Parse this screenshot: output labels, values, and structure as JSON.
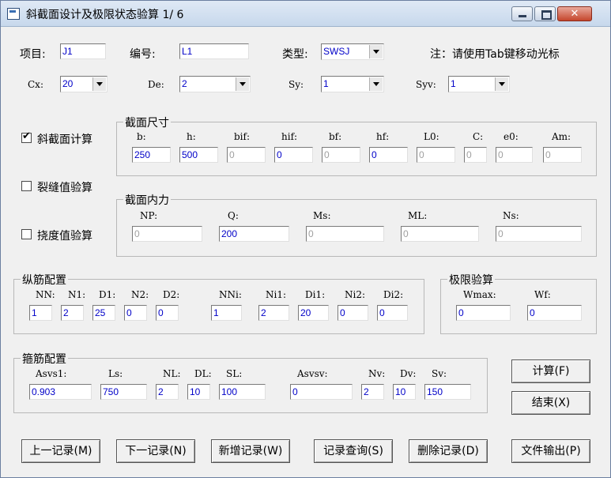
{
  "window": {
    "title": "斜截面设计及极限状态验算 1/ 6"
  },
  "top": {
    "item_label": "项目:",
    "item_value": "J1",
    "code_label": "编号:",
    "code_value": "L1",
    "type_label": "类型:",
    "type_value": "SWSJ",
    "note": "注：请使用Tab键移动光标",
    "cx_label": "Cx:",
    "cx_value": "20",
    "de_label": "De:",
    "de_value": "2",
    "sy_label": "Sy:",
    "sy_value": "1",
    "syv_label": "Syv:",
    "syv_value": "1"
  },
  "checks": {
    "oblique": "斜截面计算",
    "oblique_checked": "✔",
    "crack": "裂缝值验算",
    "deflection": "挠度值验算"
  },
  "section_size": {
    "title": "截面尺寸",
    "labels": [
      "b:",
      "h:",
      "bif:",
      "hif:",
      "bf:",
      "hf:",
      "L0:",
      "C:",
      "e0:",
      "Am:"
    ],
    "values": [
      "250",
      "500",
      "0",
      "0",
      "0",
      "0",
      "0",
      "0",
      "0",
      "0"
    ]
  },
  "section_force": {
    "title": "截面内力",
    "labels": [
      "NP:",
      "Q:",
      "Ms:",
      "ML:",
      "Ns:"
    ],
    "values": [
      "0",
      "200",
      "0",
      "0",
      "0"
    ]
  },
  "long_rebar": {
    "title": "纵筋配置",
    "labels": [
      "NN:",
      "N1:",
      "D1:",
      "N2:",
      "D2:",
      "NNi:",
      "Ni1:",
      "Di1:",
      "Ni2:",
      "Di2:"
    ],
    "values": [
      "1",
      "2",
      "25",
      "0",
      "0",
      "1",
      "2",
      "20",
      "0",
      "0"
    ]
  },
  "limit_check": {
    "title": "极限验算",
    "labels": [
      "Wmax:",
      "Wf:"
    ],
    "values": [
      "0",
      "0"
    ]
  },
  "stirrup": {
    "title": "箍筋配置",
    "labels": [
      "Asvs1:",
      "Ls:",
      "NL:",
      "DL:",
      "SL:",
      "Asvsv:",
      "Nv:",
      "Dv:",
      "Sv:"
    ],
    "values": [
      "0.903",
      "750",
      "2",
      "10",
      "100",
      "0",
      "2",
      "10",
      "150"
    ]
  },
  "buttons": {
    "calc": "计算(F)",
    "end": "结束(X)",
    "prev": "上一记录(M)",
    "next": "下一记录(N)",
    "add": "新增记录(W)",
    "query": "记录查询(S)",
    "delete": "删除记录(D)",
    "export": "文件输出(P)"
  }
}
